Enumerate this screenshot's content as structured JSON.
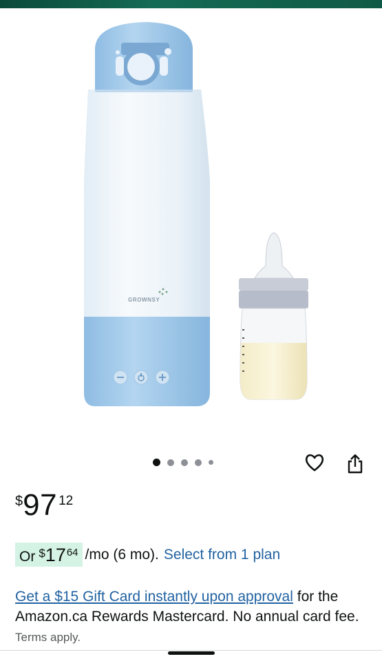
{
  "product": {
    "brand_print": "GROWNSY",
    "image_count": 5,
    "active_image_index": 0
  },
  "price": {
    "currency_symbol": "$",
    "whole": "97",
    "fraction": "12"
  },
  "financing": {
    "prefix": "Or",
    "currency_symbol": "$",
    "monthly_whole": "17",
    "monthly_fraction": "64",
    "period": "/mo (6 mo).",
    "select_plan_link": "Select from 1 plan"
  },
  "promo": {
    "link_text": "Get a $15 Gift Card instantly upon approval",
    "body_text": "for the Amazon.ca Rewards Mastercard. No annual card fee.",
    "terms_text": "Terms apply."
  },
  "icons": {
    "wishlist": "heart-outline-icon",
    "share": "share-icon"
  },
  "colors": {
    "top_bar": "#146b55",
    "link": "#2162a1",
    "financing_highlight": "#d4f3e4",
    "bottle_blue": "#a8cdec",
    "text": "#0f1111"
  }
}
